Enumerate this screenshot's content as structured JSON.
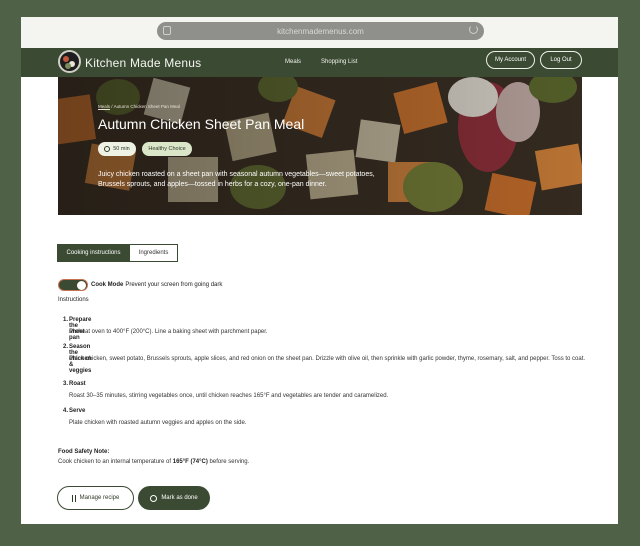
{
  "browser": {
    "url": "kitchenmademenus.com"
  },
  "navbar": {
    "brand": "Kitchen Made Menus",
    "links": [
      "Meals",
      "Shopping List"
    ],
    "account_label": "My Account",
    "logout_label": "Log Out"
  },
  "hero": {
    "breadcrumb_root": "Meals",
    "breadcrumb_sep": "/",
    "breadcrumb_current": "Autumn Chicken Sheet Pan Meal",
    "title": "Autumn Chicken Sheet Pan Meal",
    "time": "50 min",
    "tag": "Healthy Choice",
    "description": "Juicy chicken roasted on a sheet pan with seasonal autumn vegetables—sweet potatoes, Brussels sprouts, and apples—tossed in herbs for a cozy, one-pan dinner."
  },
  "tabs": {
    "instructions": "Cooking instructions",
    "ingredients": "Ingredients"
  },
  "cook_mode": {
    "label": "Cook Mode",
    "description": "Prevent your screen from going dark",
    "enabled": true
  },
  "instructions_heading": "Instructions",
  "steps": [
    {
      "num": "1.",
      "title": "Prepare the sheet pan",
      "body": "Preheat oven to 400°F (200°C). Line a baking sheet with parchment paper."
    },
    {
      "num": "2.",
      "title": "Season the chicken & veggies",
      "body": "Place chicken, sweet potato, Brussels sprouts, apple slices, and red onion on the sheet pan. Drizzle with olive oil, then sprinkle with garlic powder, thyme, rosemary, salt, and pepper. Toss to coat."
    },
    {
      "num": "3.",
      "title": "Roast",
      "body": "Roast 30–35 minutes, stirring vegetables once, until chicken reaches 165°F and vegetables are tender and caramelized."
    },
    {
      "num": "4.",
      "title": "Serve",
      "body": "Plate chicken with roasted autumn veggies and apples on the side."
    }
  ],
  "safety": {
    "heading": "Food Safety Note:",
    "pre": "Cook chicken to an internal temperature of ",
    "temp": "165°F (74°C)",
    "post": " before serving."
  },
  "buttons": {
    "manage": "Manage recipe",
    "done": "Mark as done"
  },
  "colors": {
    "brand_green": "#3b4a33",
    "page_bg": "#4f6147",
    "toggle_border": "#c87150"
  }
}
